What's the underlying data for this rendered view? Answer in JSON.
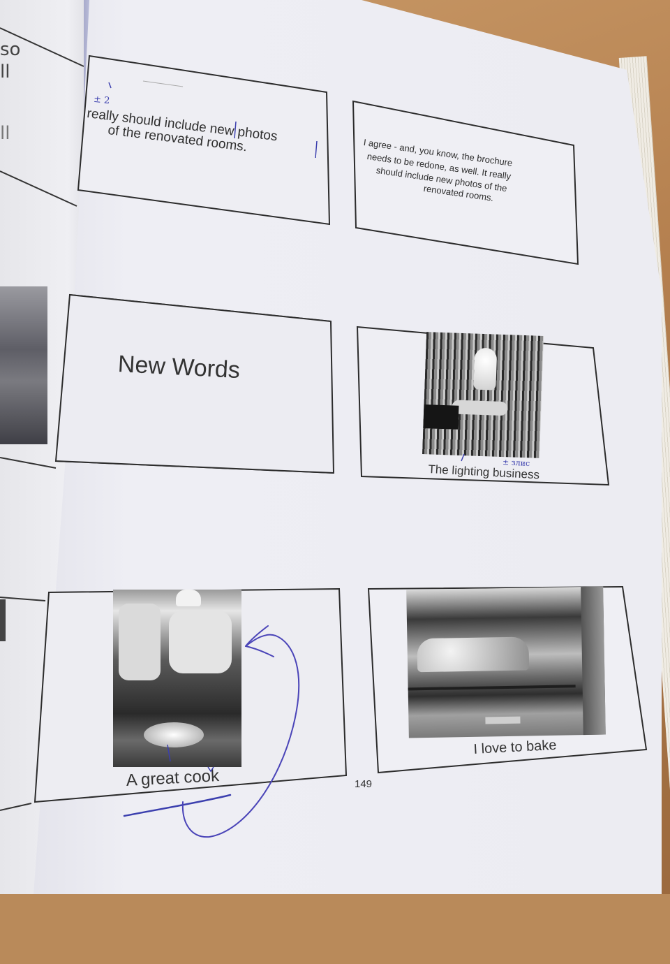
{
  "left_page": {
    "edge_text_1": "so",
    "edge_text_2": "ll",
    "edge_text_3": "ll"
  },
  "slides": {
    "top_left": {
      "text": "really should include new photos of the renovated rooms.",
      "line1": "really should include new photos",
      "line2": "of the renovated rooms."
    },
    "top_right": {
      "line1": "I agree - and, you know, the brochure",
      "line2": "needs to be redone, as well. It really",
      "line3": "should include new photos of the",
      "line4": "renovated rooms."
    },
    "middle_left": {
      "title": "New Words"
    },
    "middle_right": {
      "caption": "The lighting business",
      "image": "hand-holding-light-bulb"
    },
    "bottom_left": {
      "caption": "A great cook",
      "image": "chefs-cooking-wok"
    },
    "bottom_right": {
      "caption": "I love to bake",
      "image": "muffins-in-oven"
    }
  },
  "page_number": "149",
  "annotations": {
    "top_left_marks": "± 2",
    "lighting_mark": "± злис"
  }
}
